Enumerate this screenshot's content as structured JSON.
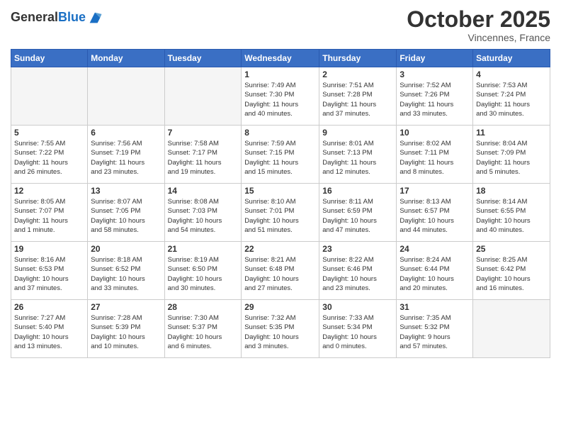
{
  "header": {
    "logo_line1": "General",
    "logo_line2": "Blue",
    "month": "October 2025",
    "location": "Vincennes, France"
  },
  "weekdays": [
    "Sunday",
    "Monday",
    "Tuesday",
    "Wednesday",
    "Thursday",
    "Friday",
    "Saturday"
  ],
  "weeks": [
    [
      {
        "day": "",
        "info": ""
      },
      {
        "day": "",
        "info": ""
      },
      {
        "day": "",
        "info": ""
      },
      {
        "day": "1",
        "info": "Sunrise: 7:49 AM\nSunset: 7:30 PM\nDaylight: 11 hours\nand 40 minutes."
      },
      {
        "day": "2",
        "info": "Sunrise: 7:51 AM\nSunset: 7:28 PM\nDaylight: 11 hours\nand 37 minutes."
      },
      {
        "day": "3",
        "info": "Sunrise: 7:52 AM\nSunset: 7:26 PM\nDaylight: 11 hours\nand 33 minutes."
      },
      {
        "day": "4",
        "info": "Sunrise: 7:53 AM\nSunset: 7:24 PM\nDaylight: 11 hours\nand 30 minutes."
      }
    ],
    [
      {
        "day": "5",
        "info": "Sunrise: 7:55 AM\nSunset: 7:22 PM\nDaylight: 11 hours\nand 26 minutes."
      },
      {
        "day": "6",
        "info": "Sunrise: 7:56 AM\nSunset: 7:19 PM\nDaylight: 11 hours\nand 23 minutes."
      },
      {
        "day": "7",
        "info": "Sunrise: 7:58 AM\nSunset: 7:17 PM\nDaylight: 11 hours\nand 19 minutes."
      },
      {
        "day": "8",
        "info": "Sunrise: 7:59 AM\nSunset: 7:15 PM\nDaylight: 11 hours\nand 15 minutes."
      },
      {
        "day": "9",
        "info": "Sunrise: 8:01 AM\nSunset: 7:13 PM\nDaylight: 11 hours\nand 12 minutes."
      },
      {
        "day": "10",
        "info": "Sunrise: 8:02 AM\nSunset: 7:11 PM\nDaylight: 11 hours\nand 8 minutes."
      },
      {
        "day": "11",
        "info": "Sunrise: 8:04 AM\nSunset: 7:09 PM\nDaylight: 11 hours\nand 5 minutes."
      }
    ],
    [
      {
        "day": "12",
        "info": "Sunrise: 8:05 AM\nSunset: 7:07 PM\nDaylight: 11 hours\nand 1 minute."
      },
      {
        "day": "13",
        "info": "Sunrise: 8:07 AM\nSunset: 7:05 PM\nDaylight: 10 hours\nand 58 minutes."
      },
      {
        "day": "14",
        "info": "Sunrise: 8:08 AM\nSunset: 7:03 PM\nDaylight: 10 hours\nand 54 minutes."
      },
      {
        "day": "15",
        "info": "Sunrise: 8:10 AM\nSunset: 7:01 PM\nDaylight: 10 hours\nand 51 minutes."
      },
      {
        "day": "16",
        "info": "Sunrise: 8:11 AM\nSunset: 6:59 PM\nDaylight: 10 hours\nand 47 minutes."
      },
      {
        "day": "17",
        "info": "Sunrise: 8:13 AM\nSunset: 6:57 PM\nDaylight: 10 hours\nand 44 minutes."
      },
      {
        "day": "18",
        "info": "Sunrise: 8:14 AM\nSunset: 6:55 PM\nDaylight: 10 hours\nand 40 minutes."
      }
    ],
    [
      {
        "day": "19",
        "info": "Sunrise: 8:16 AM\nSunset: 6:53 PM\nDaylight: 10 hours\nand 37 minutes."
      },
      {
        "day": "20",
        "info": "Sunrise: 8:18 AM\nSunset: 6:52 PM\nDaylight: 10 hours\nand 33 minutes."
      },
      {
        "day": "21",
        "info": "Sunrise: 8:19 AM\nSunset: 6:50 PM\nDaylight: 10 hours\nand 30 minutes."
      },
      {
        "day": "22",
        "info": "Sunrise: 8:21 AM\nSunset: 6:48 PM\nDaylight: 10 hours\nand 27 minutes."
      },
      {
        "day": "23",
        "info": "Sunrise: 8:22 AM\nSunset: 6:46 PM\nDaylight: 10 hours\nand 23 minutes."
      },
      {
        "day": "24",
        "info": "Sunrise: 8:24 AM\nSunset: 6:44 PM\nDaylight: 10 hours\nand 20 minutes."
      },
      {
        "day": "25",
        "info": "Sunrise: 8:25 AM\nSunset: 6:42 PM\nDaylight: 10 hours\nand 16 minutes."
      }
    ],
    [
      {
        "day": "26",
        "info": "Sunrise: 7:27 AM\nSunset: 5:40 PM\nDaylight: 10 hours\nand 13 minutes."
      },
      {
        "day": "27",
        "info": "Sunrise: 7:28 AM\nSunset: 5:39 PM\nDaylight: 10 hours\nand 10 minutes."
      },
      {
        "day": "28",
        "info": "Sunrise: 7:30 AM\nSunset: 5:37 PM\nDaylight: 10 hours\nand 6 minutes."
      },
      {
        "day": "29",
        "info": "Sunrise: 7:32 AM\nSunset: 5:35 PM\nDaylight: 10 hours\nand 3 minutes."
      },
      {
        "day": "30",
        "info": "Sunrise: 7:33 AM\nSunset: 5:34 PM\nDaylight: 10 hours\nand 0 minutes."
      },
      {
        "day": "31",
        "info": "Sunrise: 7:35 AM\nSunset: 5:32 PM\nDaylight: 9 hours\nand 57 minutes."
      },
      {
        "day": "",
        "info": ""
      }
    ]
  ]
}
